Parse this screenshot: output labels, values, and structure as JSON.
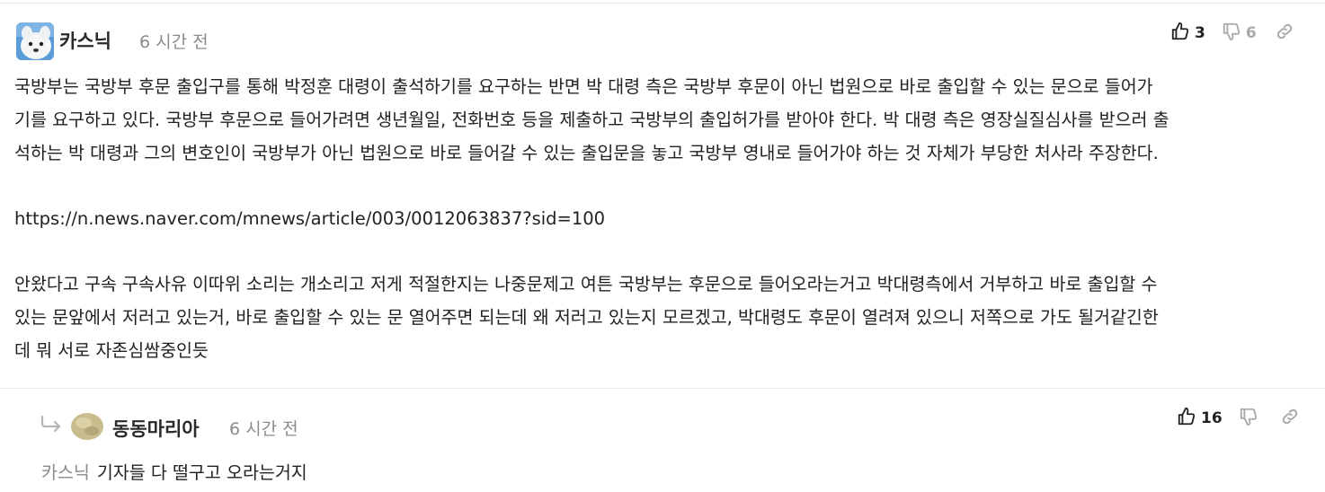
{
  "comment": {
    "author": "카스닉",
    "time": "6 시간 전",
    "likes": "3",
    "dislikes": "6",
    "paragraphs": [
      [
        "국방부는 국방부 후문 출입구를 통해 박정훈 대령이 출석하기를 요구하는 반면 박 대령 측은 국방부 후문이 아닌 법원으로 바로 출입할 수 있는 문으로 들어가",
        "기를 요구하고 있다. 국방부 후문으로 들어가려면 생년월일, 전화번호 등을 제출하고 국방부의 출입허가를 받아야 한다. 박 대령 측은 영장실질심사를 받으러 출",
        "석하는 박 대령과 그의 변호인이 국방부가 아닌 법원으로 바로 들어갈 수 있는 출입문을 놓고 국방부 영내로 들어가야 하는 것 자체가 부당한 처사라 주장한다."
      ],
      [
        "https://n.news.naver.com/mnews/article/003/0012063837?sid=100"
      ],
      [
        "안왔다고 구속 구속사유 이따위 소리는 개소리고 저게 적절한지는 나중문제고 여튼 국방부는 후문으로 들어오라는거고 박대령측에서 거부하고 바로 출입할 수",
        "있는 문앞에서 저러고 있는거, 바로 출입할 수 있는 문 열어주면 되는데 왜 저러고 있는지 모르겠고, 박대령도 후문이 열려져 있으니 저쪽으로 가도 될거같긴한",
        "데 뭐 서로 자존심쌈중인듯"
      ]
    ]
  },
  "reply": {
    "author": "동동마리아",
    "time": "6 시간 전",
    "likes": "16",
    "dislikes": "",
    "mention": "카스닉",
    "text": "기자들 다 떨구고 오라는거지"
  },
  "icons": {
    "like": "thumbs-up-icon",
    "dislike": "thumbs-down-icon",
    "link": "link-icon",
    "reply": "reply-arrow-icon"
  }
}
